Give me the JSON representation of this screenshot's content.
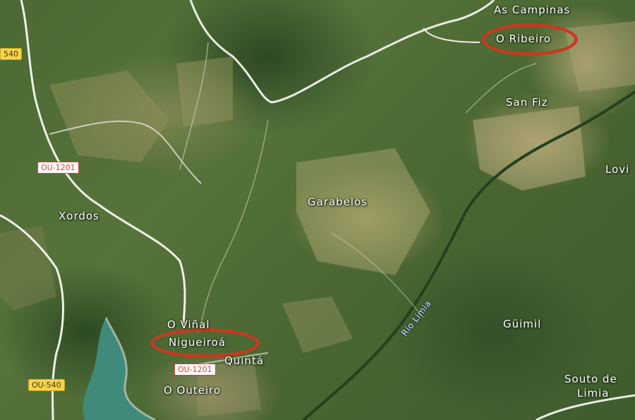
{
  "map": {
    "places": {
      "as_campinas": "As Campinas",
      "o_ribeiro": "O Ribeiro",
      "san_fiz": "San Fiz",
      "lovi": "Lovi",
      "xordos": "Xordos",
      "garabelos": "Garabelos",
      "o_vinal": "O Viñal",
      "nigueiroa": "Nigueiroá",
      "quinta": "Quintá",
      "o_outeiro": "O Outeiro",
      "guimil": "Güimil",
      "souto_line1": "Souto de",
      "souto_line2": "Limia"
    },
    "river": "Río Limia",
    "roads": {
      "ou540_top": "540",
      "ou1201_left": "OU-1201",
      "ou1201_bottom": "OU-1201",
      "ou540_bottom": "OU-540"
    },
    "highlight_color": "#c43b22"
  }
}
